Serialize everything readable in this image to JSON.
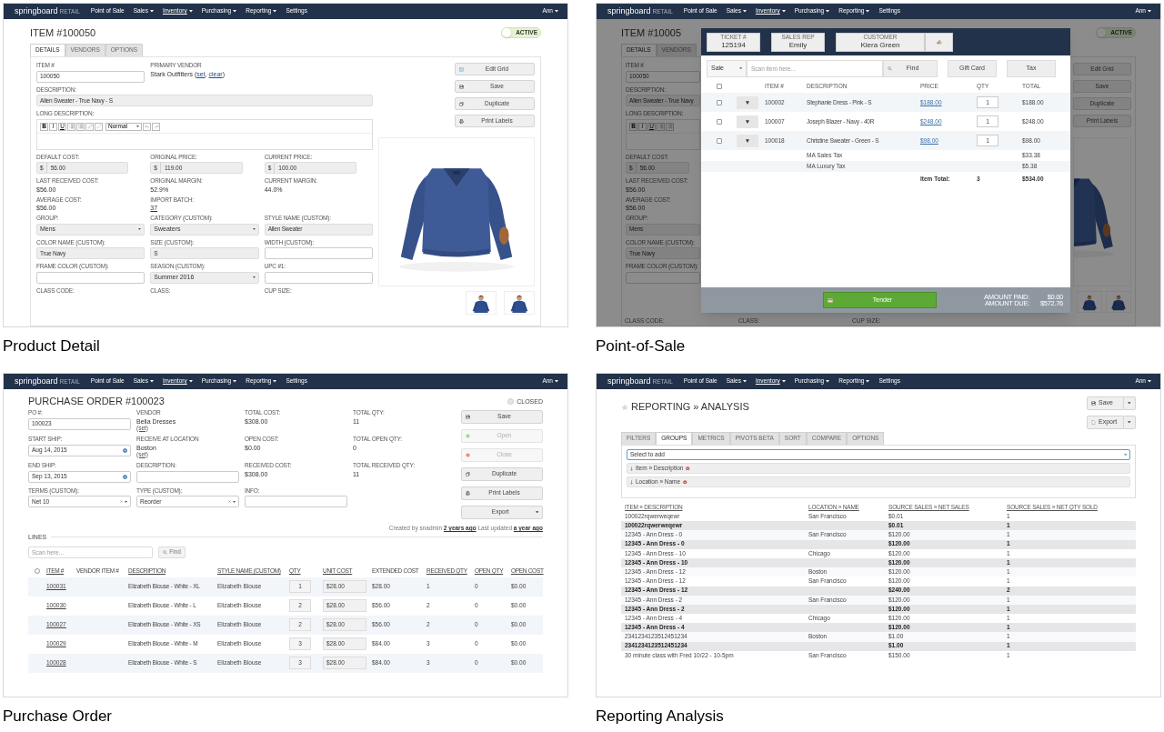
{
  "panels": [
    {
      "kind": "product_detail",
      "caption": "Product Detail",
      "nav": {
        "brand": "springboard",
        "brand_suffix": "RETAIL",
        "items": [
          {
            "label": "Point of Sale",
            "dropdown": false,
            "selected": false
          },
          {
            "label": "Sales",
            "dropdown": true,
            "selected": false
          },
          {
            "label": "Inventory",
            "dropdown": true,
            "selected": true
          },
          {
            "label": "Purchasing",
            "dropdown": true,
            "selected": false
          },
          {
            "label": "Reporting",
            "dropdown": true,
            "selected": false
          },
          {
            "label": "Settings",
            "dropdown": false,
            "selected": false
          }
        ],
        "user": {
          "label": "Ann",
          "dropdown": true
        }
      },
      "page": {
        "title": "ITEM #100050",
        "toggle": {
          "label": "ACTIVE",
          "on": true
        },
        "tabs": [
          {
            "label": "DETAILS",
            "selected": true
          },
          {
            "label": "VENDORS",
            "selected": false
          },
          {
            "label": "OPTIONS",
            "selected": false
          }
        ],
        "rows": [
          [
            {
              "label": "ITEM #",
              "kind": "input",
              "value": "100050"
            },
            {
              "label": "PRIMARY VENDOR",
              "kind": "parts",
              "parts": [
                {
                  "text": "Stark Outfitters (",
                  "link": false
                },
                {
                  "text": "set",
                  "link": true
                },
                {
                  "text": ", ",
                  "link": false
                },
                {
                  "text": "clear",
                  "link": true
                },
                {
                  "text": ")",
                  "link": false
                }
              ]
            }
          ],
          [
            {
              "label": "DESCRIPTION:",
              "kind": "readonly",
              "value": "Allen Sweater - True Navy - S"
            }
          ],
          [
            {
              "label": "LONG DESCRIPTION:",
              "kind": "editor",
              "tools": [
                {
                  "kind": "bold",
                  "label": "B"
                },
                {
                  "kind": "italic",
                  "label": "I"
                },
                {
                  "kind": "underline",
                  "label": "U"
                },
                {
                  "kind": "bullets"
                },
                {
                  "kind": "numbers"
                },
                {
                  "kind": "link"
                },
                {
                  "kind": "unlink"
                },
                {
                  "kind": "format",
                  "label": "Normal"
                },
                {
                  "kind": "undo"
                },
                {
                  "kind": "redo"
                }
              ]
            }
          ],
          [
            {
              "label": "DEFAULT COST:",
              "kind": "money",
              "prefix": "$",
              "value": "56.00"
            },
            {
              "label": "ORIGINAL PRICE:",
              "kind": "money",
              "prefix": "$",
              "value": "119.00"
            },
            {
              "label": "CURRENT PRICE:",
              "kind": "money",
              "prefix": "$",
              "value": "100.00"
            }
          ],
          [
            {
              "label": "LAST RECEIVED COST:",
              "kind": "text",
              "value": "$56.00"
            },
            {
              "label": "ORIGINAL MARGIN:",
              "kind": "text",
              "value": "52.9%"
            },
            {
              "label": "CURRENT MARGIN:",
              "kind": "text",
              "value": "44.0%"
            }
          ],
          [
            {
              "label": "AVERAGE COST:",
              "kind": "text",
              "value": "$56.00"
            },
            {
              "label": "IMPORT BATCH:",
              "kind": "link",
              "value": "37"
            }
          ],
          [
            {
              "label": "GROUP:",
              "kind": "select",
              "value": "Mens"
            },
            {
              "label": "CATEGORY (CUSTOM):",
              "kind": "select",
              "value": "Sweaters"
            },
            {
              "label": "STYLE NAME (CUSTOM):",
              "kind": "readonly",
              "value": "Allen Sweater"
            }
          ],
          [
            {
              "label": "COLOR NAME (CUSTOM):",
              "kind": "readonly",
              "value": "True Navy"
            },
            {
              "label": "SIZE (CUSTOM):",
              "kind": "readonly",
              "value": "S"
            },
            {
              "label": "WIDTH (CUSTOM):",
              "kind": "input"
            }
          ],
          [
            {
              "label": "FRAME COLOR (CUSTOM):",
              "kind": "input"
            },
            {
              "label": "SEASON (CUSTOM):",
              "kind": "select",
              "value": "Summer 2016"
            },
            {
              "label": "UPC #1:",
              "kind": "input"
            }
          ],
          [
            {
              "label": "CLASS CODE:",
              "kind": "label"
            },
            {
              "label": "CLASS:",
              "kind": "label"
            },
            {
              "label": "CUP SIZE:",
              "kind": "label"
            }
          ]
        ],
        "buttons": [
          {
            "label": "Edit Grid",
            "kind": "grid"
          },
          {
            "label": "Save",
            "kind": "save"
          },
          {
            "label": "Duplicate",
            "kind": "copy"
          },
          {
            "label": "Print Labels",
            "kind": "print"
          }
        ],
        "image": {
          "kind": "picture"
        },
        "thumbnails": [
          {
            "kind": "picture"
          },
          {
            "kind": "picture"
          }
        ]
      }
    },
    {
      "kind": "pos",
      "caption": "Point-of-Sale",
      "nav": {
        "brand": "springboard",
        "brand_suffix": "RETAIL",
        "items": [
          {
            "label": "Point of Sale",
            "dropdown": false,
            "selected": false
          },
          {
            "label": "Sales",
            "dropdown": true,
            "selected": false
          },
          {
            "label": "Inventory",
            "dropdown": true,
            "selected": true
          },
          {
            "label": "Purchasing",
            "dropdown": true,
            "selected": false
          },
          {
            "label": "Reporting",
            "dropdown": true,
            "selected": false
          },
          {
            "label": "Settings",
            "dropdown": false,
            "selected": false
          }
        ],
        "user": {
          "label": "Ann",
          "dropdown": true
        }
      },
      "background": {
        "title": "ITEM #10005",
        "toggle": {
          "label": "ACTIVE",
          "on": true
        },
        "tabs": [
          {
            "label": "DETAILS",
            "selected": true
          },
          {
            "label": "VENDORS",
            "selected": false
          }
        ],
        "fields": [
          {
            "label": "ITEM #",
            "kind": "input",
            "value": "100050"
          },
          {
            "label": "DESCRIPTION:",
            "kind": "readonly",
            "value": "Allen Sweater - True Navy"
          },
          {
            "label": "LONG DESCRIPTION:",
            "kind": "editor",
            "tools": [
              {
                "kind": "bold",
                "label": "B"
              },
              {
                "kind": "italic",
                "label": "I"
              },
              {
                "kind": "underline",
                "label": "U"
              },
              {
                "kind": "bullets"
              },
              {
                "kind": "numbers"
              }
            ]
          },
          {
            "label": "DEFAULT COST:",
            "kind": "money",
            "prefix": "$",
            "value": "56.00"
          },
          {
            "label": "LAST RECEIVED COST:",
            "kind": "text",
            "value": "$56.00"
          },
          {
            "label": "AVERAGE COST:",
            "kind": "text",
            "value": "$56.00"
          },
          {
            "label": "GROUP:",
            "kind": "readonly",
            "value": "Mens"
          },
          {
            "label": "COLOR NAME (CUSTOM):",
            "kind": "readonly",
            "value": "True Navy"
          },
          {
            "label": "FRAME COLOR (CUSTOM):",
            "kind": "input"
          }
        ],
        "bottom_labels": [
          "CLASS CODE:",
          "CLASS:",
          "CUP SIZE:"
        ],
        "buttons": [
          {
            "label": "Edit Grid"
          },
          {
            "label": "Save"
          },
          {
            "label": "Duplicate"
          },
          {
            "label": "Print Labels"
          }
        ],
        "image": {
          "kind": "picture"
        },
        "thumbnails": [
          {
            "kind": "picture"
          },
          {
            "kind": "picture"
          }
        ]
      },
      "modal": {
        "header": [
          {
            "kind": "ticket",
            "label": "TICKET #",
            "value": "125194"
          },
          {
            "kind": "rep",
            "label": "SALES REP",
            "value": "Emily"
          },
          {
            "kind": "customer",
            "label": "CUSTOMER",
            "value": "Kiera Green"
          }
        ],
        "mode": "Sale",
        "scan_placeholder": "Scan item here...",
        "find": "Find",
        "actions": [
          "Gift Card",
          "Tax"
        ],
        "select_all": {
          "checked": false
        },
        "columns": [
          "ITEM #",
          "DESCRIPTION",
          "PRICE",
          "QTY",
          "TOTAL"
        ],
        "items": [
          {
            "checked": false,
            "menu": "▼",
            "item": "100002",
            "description": "Stephanie Dress - Pink - S",
            "price": "$188.00",
            "qty": "1",
            "total": "$188.00"
          },
          {
            "checked": false,
            "menu": "▼",
            "item": "100007",
            "description": "Joseph Blazer - Navy - 40R",
            "price": "$248.00",
            "qty": "1",
            "total": "$248.00"
          },
          {
            "checked": false,
            "menu": "▼",
            "item": "100018",
            "description": "Christine Sweater - Green - S",
            "price": "$98.00",
            "qty": "1",
            "total": "$98.00"
          }
        ],
        "taxes": [
          {
            "label": "MA Sales Tax",
            "amount": "$33.38"
          },
          {
            "label": "MA Luxury Tax",
            "amount": "$5.38"
          }
        ],
        "summary": {
          "label": "Item Total:",
          "qty": "3",
          "total": "$534.00"
        },
        "tender": "Tender",
        "amounts": [
          {
            "label": "AMOUNT PAID:",
            "value": "$0.00"
          },
          {
            "label": "AMOUNT DUE:",
            "value": "$572.76"
          }
        ]
      }
    },
    {
      "kind": "purchase_order",
      "caption": "Purchase Order",
      "nav": {
        "brand": "springboard",
        "brand_suffix": "RETAIL",
        "items": [
          {
            "label": "Point of Sale",
            "dropdown": false,
            "selected": false
          },
          {
            "label": "Sales",
            "dropdown": true,
            "selected": false
          },
          {
            "label": "Inventory",
            "dropdown": true,
            "selected": true
          },
          {
            "label": "Purchasing",
            "dropdown": true,
            "selected": false
          },
          {
            "label": "Reporting",
            "dropdown": true,
            "selected": false
          },
          {
            "label": "Settings",
            "dropdown": false,
            "selected": false
          }
        ],
        "user": {
          "label": "Ann",
          "dropdown": true
        }
      },
      "page": {
        "title": "PURCHASE ORDER #100023",
        "status": {
          "label": "CLOSED",
          "on": false
        },
        "fields": [
          {
            "label": "PO #:",
            "kind": "input",
            "value": "100023"
          },
          {
            "label": "VENDOR",
            "kind": "text_set",
            "value": "Bella Dresses",
            "link": "(set)"
          },
          {
            "label": "TOTAL COST:",
            "kind": "text",
            "value": "$308.00"
          },
          {
            "label": "TOTAL QTY:",
            "kind": "text",
            "value": "11"
          },
          {
            "label": "START SHIP:",
            "kind": "date",
            "value": "Aug 14, 2015"
          },
          {
            "label": "RECEIVE AT LOCATION",
            "kind": "text_set",
            "value": "Boston",
            "link": "(set)"
          },
          {
            "label": "OPEN COST:",
            "kind": "text",
            "value": "$0.00"
          },
          {
            "label": "TOTAL OPEN QTY:",
            "kind": "text",
            "value": "0"
          },
          {
            "label": "END SHIP:",
            "kind": "date",
            "value": "Sep 13, 2015"
          },
          {
            "label": "DESCRIPTION:",
            "kind": "input"
          },
          {
            "label": "RECEIVED COST:",
            "kind": "text",
            "value": "$308.00"
          },
          {
            "label": "TOTAL RECEIVED QTY:",
            "kind": "text",
            "value": "11"
          },
          {
            "label": "TERMS (CUSTOM):",
            "kind": "clear_select",
            "value": "Net 10"
          },
          {
            "label": "TYPE (CUSTOM):",
            "kind": "clear_select",
            "value": "Reorder"
          },
          {
            "label": "INFO:",
            "kind": "input"
          }
        ],
        "buttons": [
          {
            "label": "Save",
            "kind": "save",
            "disabled": false
          },
          {
            "label": "Open",
            "kind": "open",
            "disabled": true
          },
          {
            "label": "Close",
            "kind": "close",
            "disabled": true
          },
          {
            "label": "Duplicate",
            "kind": "copy",
            "disabled": false
          },
          {
            "label": "Print Labels",
            "kind": "print",
            "disabled": false
          },
          {
            "label": "Export",
            "kind": "dropdown",
            "disabled": false
          }
        ],
        "meta": "Created by snadmin **2 years ago** Last updated **a year ago**",
        "lines": {
          "heading": "LINES",
          "search_placeholder": "Scan here...",
          "find": "Find",
          "select_all": {
            "checked": false
          },
          "columns": [
            {
              "label": "ITEM #",
              "sortable": true
            },
            {
              "label": "VENDOR ITEM #",
              "sortable": false
            },
            {
              "label": "DESCRIPTION",
              "sortable": true
            },
            {
              "label": "STYLE NAME (CUSTOM)",
              "sortable": true
            },
            {
              "label": "QTY",
              "sortable": true
            },
            {
              "label": "UNIT COST",
              "sortable": true
            },
            {
              "label": "EXTENDED COST",
              "sortable": false
            },
            {
              "label": "RECEIVED QTY",
              "sortable": true
            },
            {
              "label": "OPEN QTY",
              "sortable": true
            },
            {
              "label": "OPEN COST",
              "sortable": true
            }
          ],
          "rows": [
            {
              "item": "100031",
              "description": "Elizabeth Blouse - White - XL",
              "style": "Elizabeth Blouse",
              "qty": "1",
              "unit_cost": "$28.00",
              "extended": "$28.00",
              "received": "1",
              "open_qty": "0",
              "open_cost": "$0.00"
            },
            {
              "item": "100030",
              "description": "Elizabeth Blouse - White - L",
              "style": "Elizabeth Blouse",
              "qty": "2",
              "unit_cost": "$28.00",
              "extended": "$56.00",
              "received": "2",
              "open_qty": "0",
              "open_cost": "$0.00"
            },
            {
              "item": "100027",
              "description": "Elizabeth Blouse - White - XS",
              "style": "Elizabeth Blouse",
              "qty": "2",
              "unit_cost": "$28.00",
              "extended": "$56.00",
              "received": "2",
              "open_qty": "0",
              "open_cost": "$0.00"
            },
            {
              "item": "100029",
              "description": "Elizabeth Blouse - White - M",
              "style": "Elizabeth Blouse",
              "qty": "3",
              "unit_cost": "$28.00",
              "extended": "$84.00",
              "received": "3",
              "open_qty": "0",
              "open_cost": "$0.00"
            },
            {
              "item": "100028",
              "description": "Elizabeth Blouse - White - S",
              "style": "Elizabeth Blouse",
              "qty": "3",
              "unit_cost": "$28.00",
              "extended": "$84.00",
              "received": "3",
              "open_qty": "0",
              "open_cost": "$0.00"
            }
          ]
        }
      }
    },
    {
      "kind": "reporting",
      "caption": "Reporting Analysis",
      "nav": {
        "brand": "springboard",
        "brand_suffix": "RETAIL",
        "items": [
          {
            "label": "Point of Sale",
            "dropdown": false,
            "selected": false
          },
          {
            "label": "Sales",
            "dropdown": true,
            "selected": false
          },
          {
            "label": "Inventory",
            "dropdown": true,
            "selected": true
          },
          {
            "label": "Purchasing",
            "dropdown": true,
            "selected": false
          },
          {
            "label": "Reporting",
            "dropdown": true,
            "selected": false
          },
          {
            "label": "Settings",
            "dropdown": false,
            "selected": false
          }
        ],
        "user": {
          "label": "Ann",
          "dropdown": true
        }
      },
      "page": {
        "title": "REPORTING » ANALYSIS",
        "actions": [
          {
            "label": "Save",
            "kind": "save"
          },
          {
            "label": "Export",
            "kind": "export"
          }
        ],
        "tabs": [
          {
            "label": "FILTERS",
            "selected": false
          },
          {
            "label": "GROUPS",
            "selected": true
          },
          {
            "label": "METRICS",
            "selected": false
          },
          {
            "label": "PIVOTS BETA",
            "selected": false
          },
          {
            "label": "SORT",
            "selected": false
          },
          {
            "label": "COMPARE",
            "selected": false
          },
          {
            "label": "OPTIONS",
            "selected": false
          }
        ],
        "group_select": "Select to add",
        "groups": [
          {
            "label": "Item » Description"
          },
          {
            "label": "Location » Name"
          }
        ],
        "columns": [
          "ITEM » DESCRIPTION",
          "LOCATION » NAME",
          "SOURCE SALES » NET SALES",
          "SOURCE SALES » NET QTY SOLD"
        ],
        "rows": [
          {
            "kind": "detail",
            "description": "100022rqwerweqewr",
            "location": "San Francisco",
            "net_sales": "$0.01",
            "qty": "1"
          },
          {
            "kind": "subtotal",
            "description": "100022rqwerweqewr",
            "net_sales": "$0.01",
            "qty": "1"
          },
          {
            "kind": "detail",
            "description": "12345 - Ann Dress - 0",
            "location": "San Francisco",
            "net_sales": "$120.00",
            "qty": "1"
          },
          {
            "kind": "subtotal",
            "description": "12345 - Ann Dress - 0",
            "net_sales": "$120.00",
            "qty": "1"
          },
          {
            "kind": "detail",
            "description": "12345 - Ann Dress - 10",
            "location": "Chicago",
            "net_sales": "$120.00",
            "qty": "1"
          },
          {
            "kind": "subtotal",
            "description": "12345 - Ann Dress - 10",
            "net_sales": "$120.00",
            "qty": "1"
          },
          {
            "kind": "detail",
            "description": "12345 - Ann Dress - 12",
            "location": "Boston",
            "net_sales": "$120.00",
            "qty": "1"
          },
          {
            "kind": "detail",
            "description": "12345 - Ann Dress - 12",
            "location": "San Francisco",
            "net_sales": "$120.00",
            "qty": "1"
          },
          {
            "kind": "subtotal",
            "description": "12345 - Ann Dress - 12",
            "net_sales": "$240.00",
            "qty": "2"
          },
          {
            "kind": "detail",
            "description": "12345 - Ann Dress - 2",
            "location": "San Francisco",
            "net_sales": "$120.00",
            "qty": "1"
          },
          {
            "kind": "subtotal",
            "description": "12345 - Ann Dress - 2",
            "net_sales": "$120.00",
            "qty": "1"
          },
          {
            "kind": "detail",
            "description": "12345 - Ann Dress - 4",
            "location": "Chicago",
            "net_sales": "$120.00",
            "qty": "1"
          },
          {
            "kind": "subtotal",
            "description": "12345 - Ann Dress - 4",
            "net_sales": "$120.00",
            "qty": "1"
          },
          {
            "kind": "detail",
            "description": "2341234123512451234",
            "location": "Boston",
            "net_sales": "$1.00",
            "qty": "1"
          },
          {
            "kind": "subtotal",
            "description": "2341234123512451234",
            "net_sales": "$1.00",
            "qty": "1"
          },
          {
            "kind": "detail",
            "description": "30 minute class with Fred 10/22 - 10-5pm",
            "location": "San Francisco",
            "net_sales": "$150.00",
            "qty": "1"
          }
        ]
      }
    }
  ]
}
